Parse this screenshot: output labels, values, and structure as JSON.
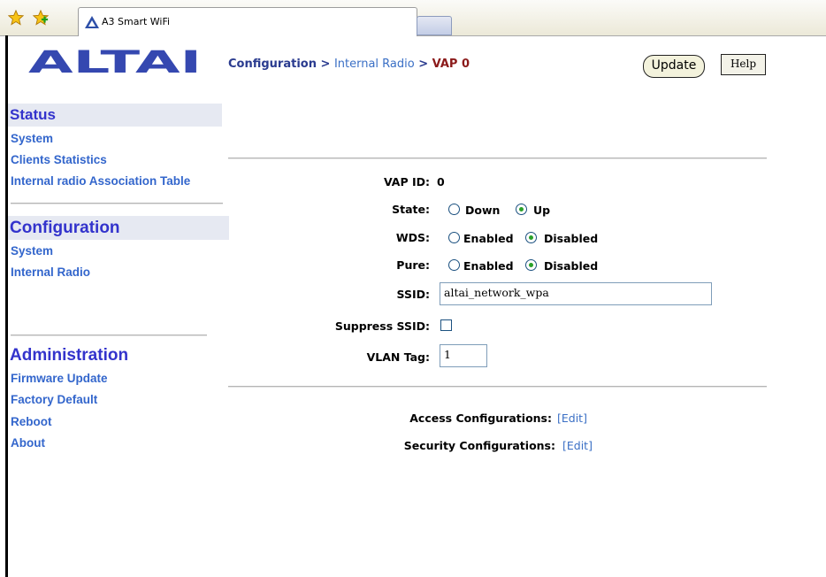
{
  "browser": {
    "tab_title": "A3 Smart WiFi"
  },
  "logo_text": "ALTAI",
  "sidebar": {
    "status": {
      "heading": "Status",
      "items": [
        "System",
        "Clients Statistics",
        "Internal radio Association Table"
      ]
    },
    "configuration": {
      "heading": "Configuration",
      "items": [
        "System",
        "Internal Radio"
      ]
    },
    "administration": {
      "heading": "Administration",
      "items": [
        "Firmware Update",
        "Factory Default",
        "Reboot",
        "About"
      ]
    }
  },
  "breadcrumb": {
    "part1": "Configuration",
    "sep": ">",
    "part2": "Internal Radio",
    "part3": "VAP 0"
  },
  "buttons": {
    "update": "Update",
    "help": "Help"
  },
  "form": {
    "vap_id_label": "VAP ID:",
    "vap_id_value": "0",
    "state_label": "State:",
    "state_options": [
      "Down",
      "Up"
    ],
    "state_selected": "Up",
    "wds_label": "WDS:",
    "wds_options": [
      "Enabled",
      "Disabled"
    ],
    "wds_selected": "Disabled",
    "pure_label": "Pure:",
    "pure_options": [
      "Enabled",
      "Disabled"
    ],
    "pure_selected": "Disabled",
    "ssid_label": "SSID:",
    "ssid_value": "altai_network_wpa",
    "suppress_label": "Suppress SSID:",
    "suppress_checked": false,
    "vlan_label": "VLAN Tag:",
    "vlan_value": "1"
  },
  "links": {
    "access_label": "Access Configurations:",
    "security_label": "Security Configurations:",
    "edit": "[Edit]"
  },
  "colors": {
    "sidebar_heading": "#3333cc",
    "sidebar_link": "#3366cc",
    "radio_selected": "#2aa12a"
  }
}
